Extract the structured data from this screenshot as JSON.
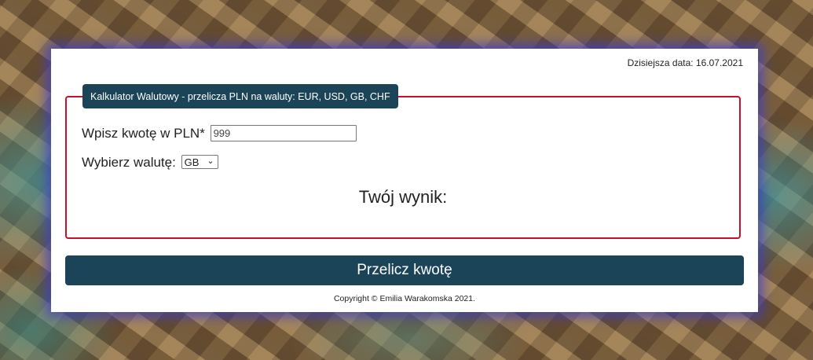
{
  "header": {
    "date_text": "Dzisiejsza data: 16.07.2021"
  },
  "form": {
    "legend": "Kalkulator Walutowy - przelicza PLN na waluty: EUR, USD, GB, CHF",
    "amount_label": "Wpisz kwotę w PLN*",
    "amount_value": "999",
    "currency_label": "Wybierz walutę:",
    "currency_selected": "GB",
    "result_label": "Twój wynik:"
  },
  "actions": {
    "submit_label": "Przelicz kwotę"
  },
  "footer": {
    "copyright": "Copyright © Emilia Warakomska 2021."
  },
  "colors": {
    "accent": "#1c4459",
    "border": "#c8102e"
  }
}
